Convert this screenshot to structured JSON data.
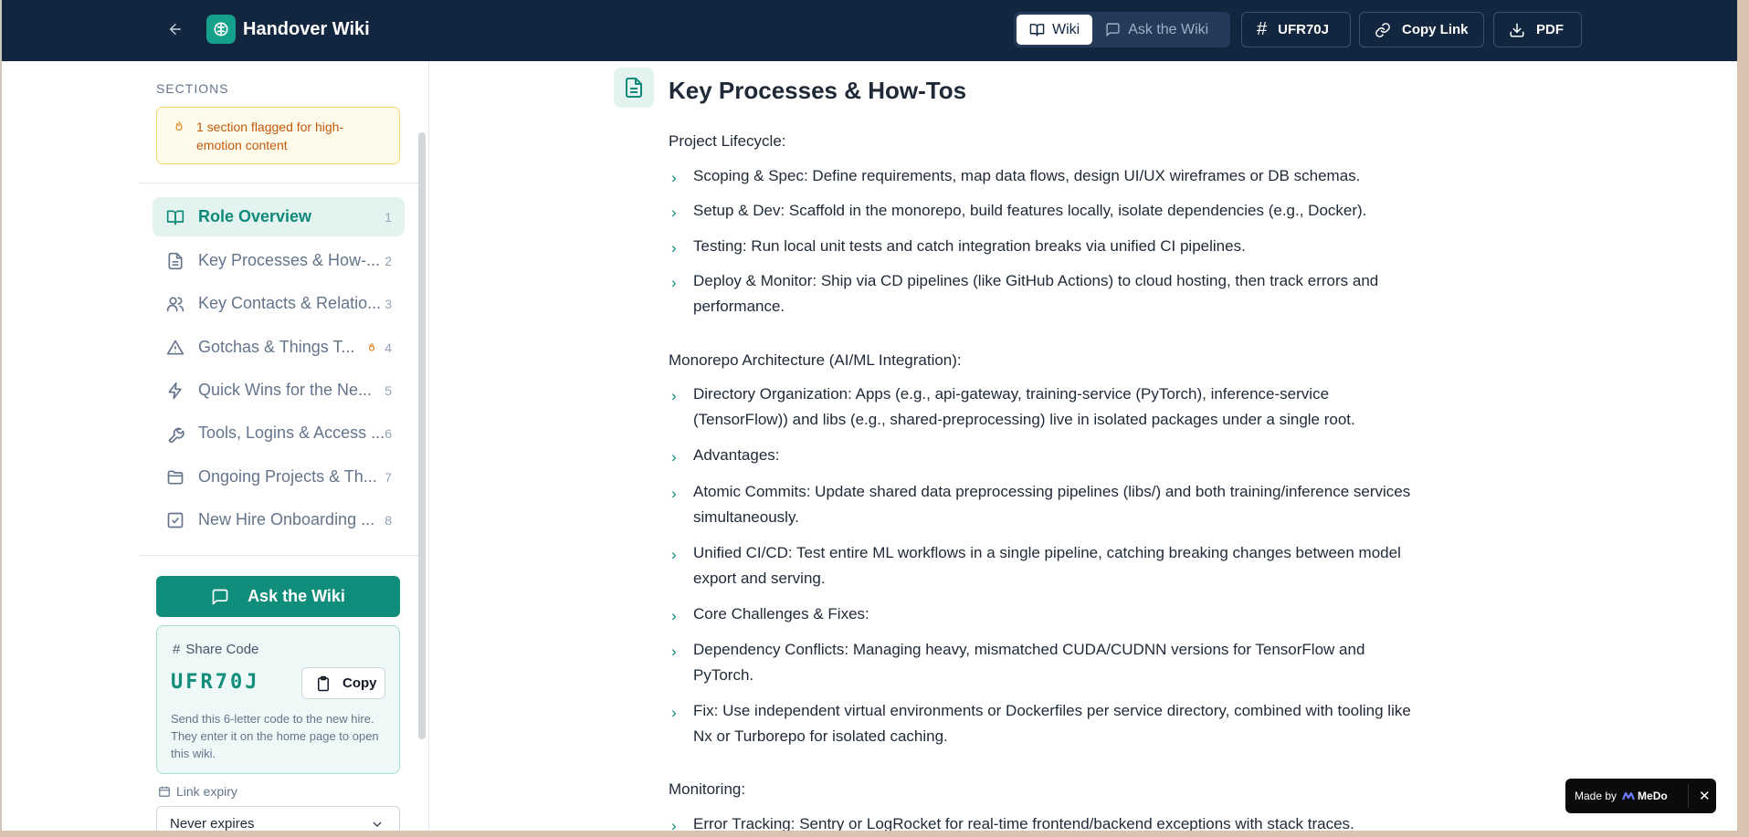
{
  "header": {
    "title": "Handover Wiki",
    "tabs": [
      {
        "label": "Wiki",
        "active": true
      },
      {
        "label": "Ask the Wiki",
        "active": false
      }
    ],
    "code_label": "UFR70J",
    "copy_link_label": "Copy Link",
    "pdf_label": "PDF"
  },
  "sidebar": {
    "sections_heading": "SECTIONS",
    "flag_notice": "1 section flagged for high-emotion content",
    "items": [
      {
        "label": "Role Overview",
        "num": "1",
        "icon": "book-icon",
        "active": true
      },
      {
        "label": "Key Processes & How-...",
        "num": "2",
        "icon": "document-icon"
      },
      {
        "label": "Key Contacts & Relatio...",
        "num": "3",
        "icon": "users-icon"
      },
      {
        "label": "Gotchas & Things T...",
        "num": "4",
        "icon": "warning-icon",
        "flagged": true
      },
      {
        "label": "Quick Wins for the Ne...",
        "num": "5",
        "icon": "lightning-icon"
      },
      {
        "label": "Tools, Logins & Access ...",
        "num": "6",
        "icon": "wrench-icon"
      },
      {
        "label": "Ongoing Projects & Th...",
        "num": "7",
        "icon": "folder-icon"
      },
      {
        "label": "New Hire Onboarding ...",
        "num": "8",
        "icon": "checkbox-icon"
      }
    ],
    "ask_button": "Ask the Wiki",
    "share": {
      "title": "Share Code",
      "code": "UFR70J",
      "copy_label": "Copy",
      "help": "Send this 6-letter code to the new hire. They enter it on the home page to open this wiki."
    },
    "expiry": {
      "label": "Link expiry",
      "value": "Never expires"
    }
  },
  "main": {
    "section_title": "Key Processes & How-Tos",
    "blocks": {
      "lifecycle_heading": "Project Lifecycle:",
      "lifecycle": [
        "Scoping & Spec: Define requirements, map data flows, design UI/UX wireframes or DB schemas.",
        "Setup & Dev: Scaffold in the monorepo, build features locally, isolate dependencies (e.g., Docker).",
        "Testing: Run local unit tests and catch integration breaks via unified CI pipelines.",
        "Deploy & Monitor: Ship via CD pipelines (like GitHub Actions) to cloud hosting, then track errors and performance."
      ],
      "monorepo_heading": "Monorepo Architecture (AI/ML Integration):",
      "monorepo": [
        "Directory Organization: Apps (e.g., api-gateway, training-service (PyTorch), inference-service (TensorFlow)) and libs (e.g., shared-preprocessing) live in isolated packages under a single root.",
        "Advantages:",
        "Atomic Commits: Update shared data preprocessing pipelines (libs/) and both training/inference services simultaneously.",
        "Unified CI/CD: Test entire ML workflows in a single pipeline, catching breaking changes between model export and serving.",
        "Core Challenges & Fixes:",
        "Dependency Conflicts: Managing heavy, mismatched CUDA/CUDNN versions for TensorFlow and PyTorch.",
        "Fix: Use independent virtual environments or Dockerfiles per service directory, combined with tooling like Nx or Turborepo for isolated caching."
      ],
      "monitoring_heading": "Monitoring:",
      "monitoring": [
        "Error Tracking: Sentry or LogRocket for real-time frontend/backend exceptions with stack traces."
      ]
    }
  },
  "badge": {
    "made_by": "Made by",
    "brand": "MeDo"
  },
  "colors": {
    "header_bg": "#132640",
    "accent": "#118d7c",
    "flag_bg": "#fffbea",
    "flag_text": "#c2590e"
  }
}
